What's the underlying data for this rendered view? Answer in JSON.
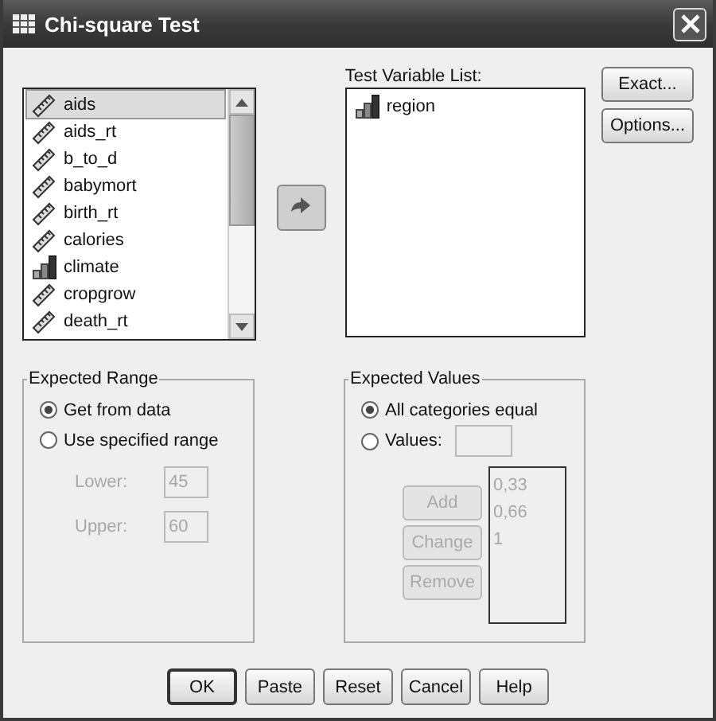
{
  "window": {
    "title": "Chi-square Test"
  },
  "variables": [
    {
      "name": "aids",
      "kind": "scale",
      "selected": true
    },
    {
      "name": "aids_rt",
      "kind": "scale",
      "selected": false
    },
    {
      "name": "b_to_d",
      "kind": "scale",
      "selected": false
    },
    {
      "name": "babymort",
      "kind": "scale",
      "selected": false
    },
    {
      "name": "birth_rt",
      "kind": "scale",
      "selected": false
    },
    {
      "name": "calories",
      "kind": "scale",
      "selected": false
    },
    {
      "name": "climate",
      "kind": "nominal",
      "selected": false
    },
    {
      "name": "cropgrow",
      "kind": "scale",
      "selected": false
    },
    {
      "name": "death_rt",
      "kind": "scale",
      "selected": false
    }
  ],
  "test_variable_list": {
    "label": "Test Variable List:",
    "items": [
      {
        "name": "region",
        "kind": "nominal"
      }
    ]
  },
  "side_buttons": [
    "Exact...",
    "Options..."
  ],
  "expected_range": {
    "title": "Expected Range",
    "options": [
      {
        "label": "Get from data",
        "selected": true
      },
      {
        "label": "Use specified range",
        "selected": false
      }
    ],
    "fields": [
      {
        "label": "Lower:",
        "value": "45",
        "disabled": true
      },
      {
        "label": "Upper:",
        "value": "60",
        "disabled": true
      }
    ]
  },
  "expected_values": {
    "title": "Expected Values",
    "options": [
      {
        "label": "All categories equal",
        "selected": true
      },
      {
        "label": "Values:",
        "selected": false
      }
    ],
    "buttons": [
      {
        "label": "Add",
        "disabled": true
      },
      {
        "label": "Change",
        "disabled": true
      },
      {
        "label": "Remove",
        "disabled": true
      }
    ],
    "values_list": {
      "disabled": true,
      "items": [
        "0,33",
        "0,66",
        "1"
      ]
    }
  },
  "buttons": [
    {
      "label": "OK",
      "default": true
    },
    {
      "label": "Paste",
      "default": false
    },
    {
      "label": "Reset",
      "default": false
    },
    {
      "label": "Cancel",
      "default": false
    },
    {
      "label": "Help",
      "default": false
    }
  ]
}
